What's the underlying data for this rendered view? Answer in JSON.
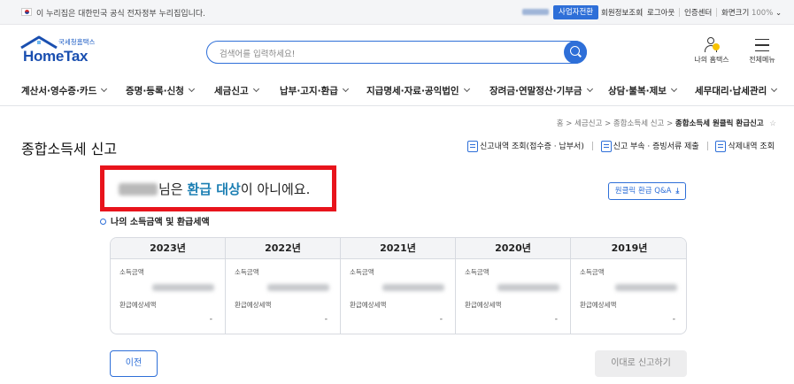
{
  "gov_bar": {
    "notice": "이 누리집은 대한민국 공식 전자정부 누리집입니다.",
    "biz_switch": "사업자전환",
    "links": [
      "회원정보조회",
      "로그아웃",
      "인증센터",
      "화면크기"
    ],
    "zoom": "100%"
  },
  "header": {
    "logo_sub": "국세청홈택스",
    "logo_main": "HomeTax",
    "search_placeholder": "검색어를 입력하세요!",
    "my_hometax": "나의 홈택스",
    "all_menu": "전체메뉴"
  },
  "gnb": [
    "계산서·영수증·카드",
    "증명·등록·신청",
    "세금신고",
    "납부·고지·환급",
    "지급명세·자료·공익법인",
    "장려금·연말정산·기부금",
    "상담·불복·제보",
    "세무대리·납세관리"
  ],
  "breadcrumb": {
    "items": [
      "홈",
      "세금신고",
      "종합소득세 신고"
    ],
    "current": "종합소득세 원클릭 환급신고",
    "separator": ">"
  },
  "page": {
    "title": "종합소득세 신고",
    "link_history": "신고내역 조회(접수증 · 납부서)",
    "link_docs": "신고 부속 · 증빙서류 제출",
    "link_deleted": "삭제내역 조회"
  },
  "notice": {
    "suffix": "님은 ",
    "highlight": "환급 대상",
    "end": "이 아니에요."
  },
  "qa_button": "원클릭 환급 Q&A",
  "section_title": "나의 소득금액 및 환급세액",
  "years": [
    {
      "year": "2023년",
      "income_label": "소득금액",
      "refund_label": "환급예상세액",
      "refund": "-"
    },
    {
      "year": "2022년",
      "income_label": "소득금액",
      "refund_label": "환급예상세액",
      "refund": "-"
    },
    {
      "year": "2021년",
      "income_label": "소득금액",
      "refund_label": "환급예상세액",
      "refund": "-"
    },
    {
      "year": "2020년",
      "income_label": "소득금액",
      "refund_label": "환급예상세액",
      "refund": "-"
    },
    {
      "year": "2019년",
      "income_label": "소득금액",
      "refund_label": "환급예상세액",
      "refund": "-"
    }
  ],
  "buttons": {
    "prev": "이전",
    "submit": "이대로 신고하기"
  },
  "colors": {
    "accent": "#2e6fd8",
    "highlight": "#1c7fb3",
    "alert_border": "#e8141c"
  }
}
